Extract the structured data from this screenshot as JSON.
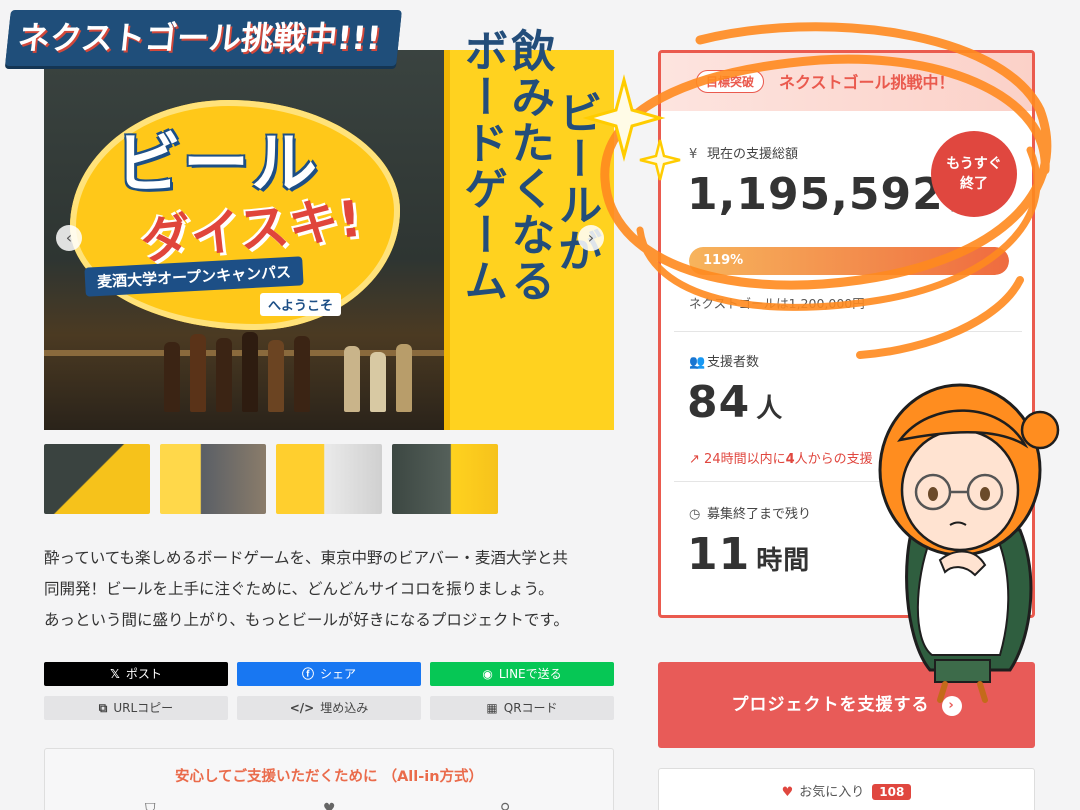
{
  "hero": {
    "banner": "ネクストゴール挑戦中!!!",
    "vertical_lines": [
      "ビールが",
      "飲みたくなる",
      "ボードゲーム"
    ],
    "logo_main": "ビール",
    "logo_sub": "ダイスキ!",
    "logo_ribbon": "麦酒大学オープンキャンパス",
    "logo_ribbon2": "へようこそ",
    "prev_arrow": "‹",
    "next_arrow": "›"
  },
  "thumbnails": [
    {
      "label": "thumbnail 1",
      "color": "#f6c21b"
    },
    {
      "label": "thumbnail 2",
      "color": "#ffd84a"
    },
    {
      "label": "thumbnail 3",
      "color": "#ffcf2e"
    },
    {
      "label": "thumbnail 4",
      "color": "#3c4742"
    }
  ],
  "description": {
    "line1": "酔っていても楽しめるボードゲームを、東京中野のビアバー・麦酒大学と共",
    "line2": "同開発！ビールを上手に注ぐために、どんどんサイコロを振りましょう。",
    "line3": "あっという間に盛り上がり、もっとビールが好きになるプロジェクトです。"
  },
  "share": {
    "post": "ポスト",
    "share": "シェア",
    "line": "LINEで送る",
    "url_copy": "URLコピー",
    "embed": "埋め込み",
    "qr": "QRコード"
  },
  "assurance": {
    "title": "安心してご支援いただくために （All-in方式）"
  },
  "panel": {
    "goal_badge": "目標突破",
    "goal_text": "ネクストゴール挑戦中！",
    "total_label": "現在の支援総額",
    "total_value": "1,195,592",
    "total_unit": "円",
    "soon_line1": "もうすぐ",
    "soon_line2": "終了",
    "progress_text": "119%",
    "progress_percent": 119,
    "next_goal": "ネクストゴールは1,200,000円",
    "supporters_label": "支援者数",
    "supporters_value": "84",
    "supporters_unit": "人",
    "trend_prefix": "24時間以内に",
    "trend_count": "4",
    "trend_suffix": "人からの支援",
    "remaining_label": "募集終了まで残り",
    "remaining_value": "11",
    "remaining_unit": "時間"
  },
  "support_button": {
    "label": "プロジェクトを支援する",
    "arrow": "›"
  },
  "favorite": {
    "label": "お気に入り",
    "count": "108"
  },
  "colors": {
    "accent_red": "#e85b58",
    "panel_border": "#ea5a4e",
    "x_black": "#000000",
    "facebook_blue": "#1877f2",
    "line_green": "#06c755",
    "scribble_orange": "#ff8a1f"
  }
}
